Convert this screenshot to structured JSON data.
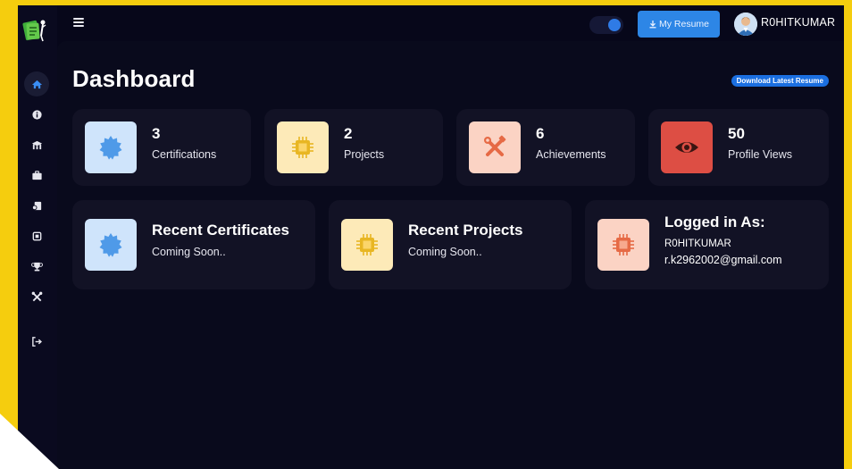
{
  "topbar": {
    "resume_button_label": "My Resume",
    "username": "R0HITKUMAR"
  },
  "sidebar": {
    "items": [
      {
        "icon": "home-icon",
        "active": true
      },
      {
        "icon": "info-icon"
      },
      {
        "icon": "education-icon"
      },
      {
        "icon": "briefcase-icon"
      },
      {
        "icon": "certificate-icon"
      },
      {
        "icon": "chip-icon"
      },
      {
        "icon": "trophy-icon"
      },
      {
        "icon": "tools-icon"
      },
      {
        "icon": "logout-icon"
      }
    ]
  },
  "page": {
    "title": "Dashboard",
    "download_label": "Download Latest Resume"
  },
  "stats": [
    {
      "value": "3",
      "label": "Certifications",
      "icon": "badge-icon",
      "tile_color": "#cfe4fb",
      "icon_color": "#4f9ae8"
    },
    {
      "value": "2",
      "label": "Projects",
      "icon": "chip-icon",
      "tile_color": "#fdeab8",
      "icon_color": "#e8b623"
    },
    {
      "value": "6",
      "label": "Achievements",
      "icon": "tools-icon",
      "tile_color": "#fbd3c4",
      "icon_color": "#e66a45"
    },
    {
      "value": "50",
      "label": "Profile Views",
      "icon": "eye-icon",
      "tile_color": "#dd4e44",
      "icon_color": "#3a1512"
    }
  ],
  "panels": {
    "recent_certificates": {
      "title": "Recent Certificates",
      "subtitle": "Coming Soon.."
    },
    "recent_projects": {
      "title": "Recent Projects",
      "subtitle": "Coming Soon.."
    },
    "logged_in": {
      "title": "Logged in As:",
      "name": "R0HITKUMAR",
      "email": "r.k2962002@gmail.com"
    }
  },
  "colors": {
    "frame": "#f5cd0e",
    "background": "#07071a",
    "card": "#121225",
    "accent": "#2d86e6"
  }
}
